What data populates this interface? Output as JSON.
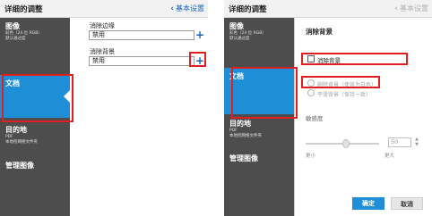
{
  "left_panel": {
    "header": {
      "title": "详细的调整",
      "back_label": "基本设置"
    },
    "sidebar": {
      "image": {
        "title": "图像",
        "line1": "彩色（24 位 RGB）",
        "line2": "默认通过度"
      },
      "document": {
        "title": "文档"
      },
      "destination": {
        "title": "目的地",
        "line1": "PDF",
        "line2": "本地检网络文件夹"
      },
      "manage": {
        "title": "管理图像"
      }
    },
    "content": {
      "edge_label": "消除边缘",
      "edge_value": "禁用",
      "bg_label": "消除背景",
      "bg_value": "禁用",
      "plus_symbol": "+"
    }
  },
  "right_panel": {
    "header": {
      "title": "详细的调整",
      "back_label": "基本设置"
    },
    "sidebar": {
      "image": {
        "title": "图像",
        "line1": "彩色（24 位 RGB）",
        "line2": "默认通过度"
      },
      "document": {
        "title": "文档"
      },
      "destination": {
        "title": "目的地",
        "line1": "PDF",
        "line2": "本地检网络文件夹"
      },
      "manage": {
        "title": "管理图像"
      }
    },
    "dialog": {
      "title": "消除背景",
      "checkbox_label": "消除背景",
      "radio1": "删除背景（使其为白色）",
      "radio2": "平滑背景（保持一致）",
      "sensitivity_label": "敏感度",
      "slider_value": "50",
      "slider_level_percent": 50,
      "min_label": "更小",
      "max_label": "更大",
      "ok_label": "确定",
      "cancel_label": "取消"
    }
  }
}
